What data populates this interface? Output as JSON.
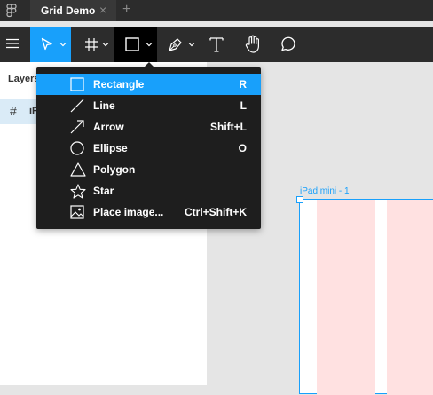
{
  "titlebar": {
    "tab_title": "Grid Demo",
    "close_glyph": "×",
    "new_tab_glyph": "+"
  },
  "toolbar": {
    "tools": [
      "menu-icon",
      "move-tool",
      "frame-tool",
      "shape-tool",
      "pen-tool",
      "text-tool",
      "hand-tool",
      "comment-tool"
    ]
  },
  "layers": {
    "label": "Layers",
    "items": [
      {
        "name": "iP"
      }
    ]
  },
  "canvas": {
    "frame_label": "iPad mini - 1"
  },
  "shape_menu": {
    "items": [
      {
        "label": "Rectangle",
        "shortcut": "R",
        "icon": "rectangle-icon",
        "selected": true
      },
      {
        "label": "Line",
        "shortcut": "L",
        "icon": "line-icon",
        "selected": false
      },
      {
        "label": "Arrow",
        "shortcut": "Shift+L",
        "icon": "arrow-icon",
        "selected": false
      },
      {
        "label": "Ellipse",
        "shortcut": "O",
        "icon": "ellipse-icon",
        "selected": false
      },
      {
        "label": "Polygon",
        "shortcut": "",
        "icon": "polygon-icon",
        "selected": false
      },
      {
        "label": "Star",
        "shortcut": "",
        "icon": "star-icon",
        "selected": false
      },
      {
        "label": "Place image...",
        "shortcut": "Ctrl+Shift+K",
        "icon": "image-icon",
        "selected": false
      }
    ]
  },
  "colors": {
    "accent": "#18a0fb",
    "toolbar_bg": "#2c2c2c",
    "menu_bg": "#1e1e1e",
    "grid_column": "#ffe1e1"
  }
}
